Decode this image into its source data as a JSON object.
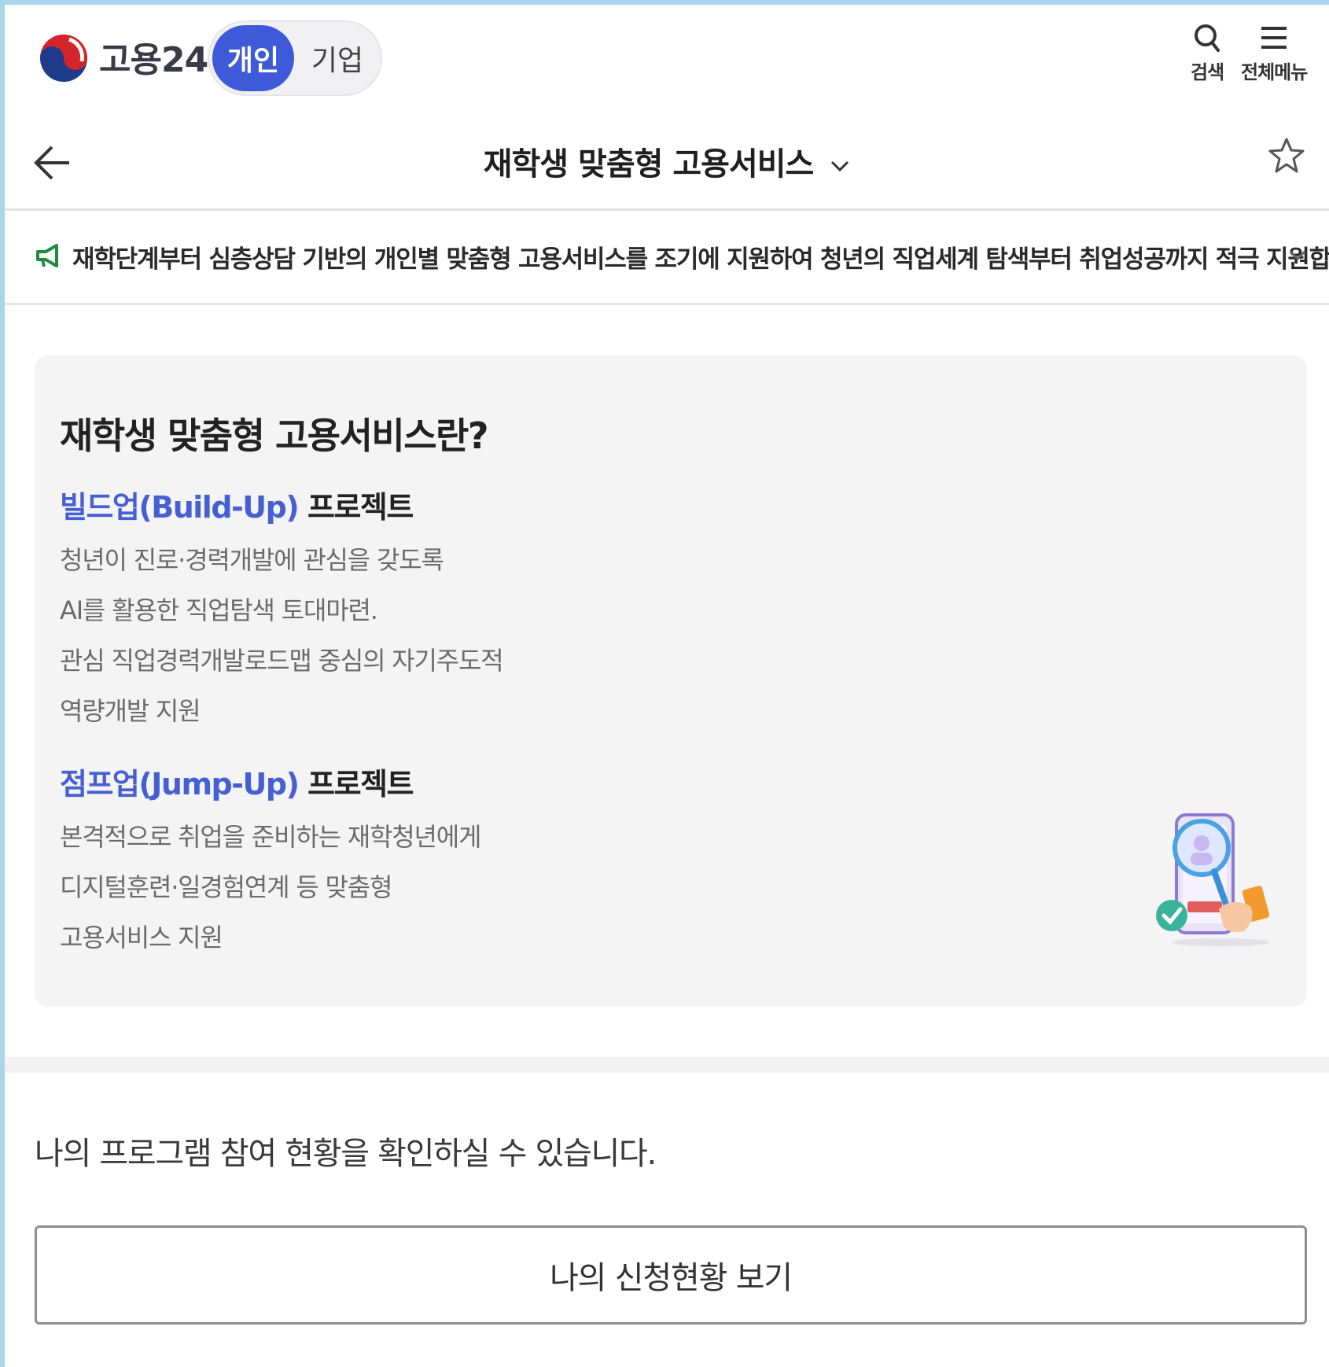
{
  "header": {
    "logo_text": "고용24",
    "toggle": {
      "active": "개인",
      "inactive": "기업"
    },
    "search_label": "검색",
    "menu_label": "전체메뉴"
  },
  "titlebar": {
    "title": "재학생 맞춤형 고용서비스"
  },
  "notice": {
    "text": "재학단계부터 심층상담 기반의 개인별 맞춤형 고용서비스를 조기에 지원하여 청년의 직업세계 탐색부터 취업성공까지 적극 지원합니다."
  },
  "card": {
    "title": "재학생 맞춤형 고용서비스란?",
    "projects": [
      {
        "name": "빌드업(Build-Up)",
        "suffix": "프로젝트",
        "lines": [
          "청년이 진로·경력개발에 관심을 갖도록",
          "AI를 활용한 직업탐색 토대마련.",
          "관심 직업경력개발로드맵 중심의 자기주도적",
          "역량개발 지원"
        ]
      },
      {
        "name": "점프업(Jump-Up)",
        "suffix": "프로젝트",
        "lines": [
          "본격적으로 취업을 준비하는 재학청년에게",
          "디지털훈련·일경험연계 등 맞춤형",
          "고용서비스 지원"
        ]
      }
    ]
  },
  "status": {
    "text": "나의 프로그램 참여 현황을 확인하실 수 있습니다.",
    "button_label": "나의 신청현황 보기"
  },
  "colors": {
    "accent": "#3f5ad8",
    "accent_text": "#4660d4",
    "card_bg": "#f4f4f5",
    "notice_icon": "#1f8a3a"
  },
  "icons": [
    "logo-taegeuk",
    "search-icon",
    "menu-icon",
    "back-arrow-icon",
    "chevron-down-icon",
    "star-icon",
    "megaphone-icon",
    "phone-search-illustration"
  ]
}
